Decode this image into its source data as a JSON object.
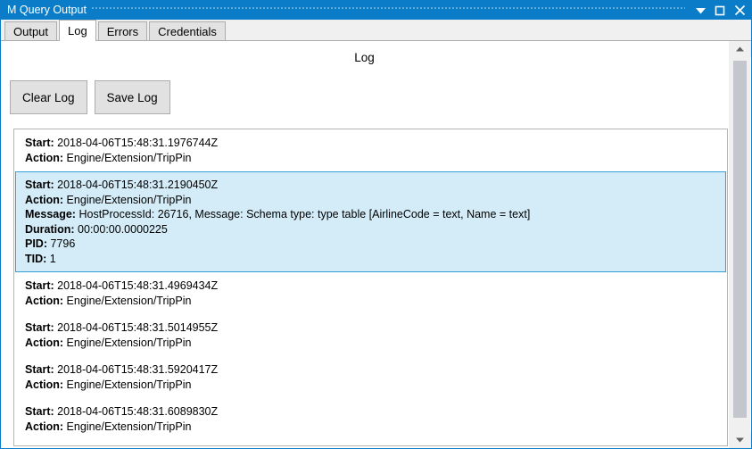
{
  "window": {
    "title": "M Query Output",
    "accent_color": "#0a7cc8",
    "buttons": {
      "minimize_label": "▼",
      "maximize_label": "□",
      "close_label": "✕"
    }
  },
  "tabs": [
    {
      "label": "Output",
      "active": false
    },
    {
      "label": "Log",
      "active": true
    },
    {
      "label": "Errors",
      "active": false
    },
    {
      "label": "Credentials",
      "active": false
    }
  ],
  "main": {
    "page_title": "Log",
    "toolbar": {
      "clear_log_label": "Clear Log",
      "save_log_label": "Save Log"
    },
    "selection_color": "#d3ecf8",
    "selection_border_color": "#2f9fd5",
    "log_entries": [
      {
        "selected": false,
        "fields": [
          {
            "label": "Start:",
            "value": "2018-04-06T15:48:31.1976744Z"
          },
          {
            "label": "Action:",
            "value": "Engine/Extension/TripPin"
          }
        ]
      },
      {
        "selected": true,
        "fields": [
          {
            "label": "Start:",
            "value": "2018-04-06T15:48:31.2190450Z"
          },
          {
            "label": "Action:",
            "value": "Engine/Extension/TripPin"
          },
          {
            "label": "Message:",
            "value": "HostProcessId: 26716, Message: Schema type: type table [AirlineCode = text, Name = text]"
          },
          {
            "label": "Duration:",
            "value": "00:00:00.0000225"
          },
          {
            "label": "PID:",
            "value": "7796"
          },
          {
            "label": "TID:",
            "value": "1"
          }
        ]
      },
      {
        "selected": false,
        "fields": [
          {
            "label": "Start:",
            "value": "2018-04-06T15:48:31.4969434Z"
          },
          {
            "label": "Action:",
            "value": "Engine/Extension/TripPin"
          }
        ]
      },
      {
        "selected": false,
        "fields": [
          {
            "label": "Start:",
            "value": "2018-04-06T15:48:31.5014955Z"
          },
          {
            "label": "Action:",
            "value": "Engine/Extension/TripPin"
          }
        ]
      },
      {
        "selected": false,
        "fields": [
          {
            "label": "Start:",
            "value": "2018-04-06T15:48:31.5920417Z"
          },
          {
            "label": "Action:",
            "value": "Engine/Extension/TripPin"
          }
        ]
      },
      {
        "selected": false,
        "fields": [
          {
            "label": "Start:",
            "value": "2018-04-06T15:48:31.6089830Z"
          },
          {
            "label": "Action:",
            "value": "Engine/Extension/TripPin"
          }
        ]
      }
    ]
  },
  "scrollbar": {
    "up_arrow_label": "▲",
    "down_arrow_label": "▼"
  }
}
